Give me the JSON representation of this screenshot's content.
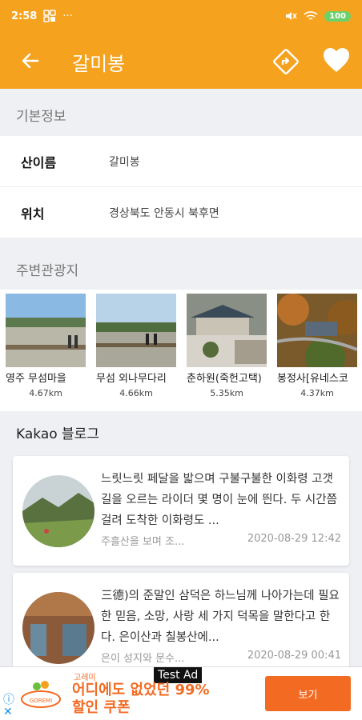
{
  "status": {
    "time": "2:58",
    "battery": "100"
  },
  "header": {
    "title": "갈미봉"
  },
  "basic_info": {
    "section_title": "기본정보",
    "rows": [
      {
        "label": "산이름",
        "value": "갈미봉"
      },
      {
        "label": "위치",
        "value": "경상북도 안동시 북후면"
      }
    ]
  },
  "nearby": {
    "section_title": "주변관광지",
    "items": [
      {
        "name": "영주 무섬마을",
        "distance": "4.67km"
      },
      {
        "name": "무섬 외나무다리",
        "distance": "4.66km"
      },
      {
        "name": "춘하원(죽헌고택)",
        "distance": "5.35km"
      },
      {
        "name": "봉정사[유네스코",
        "distance": "4.37km"
      }
    ]
  },
  "blog": {
    "section_title": "Kakao 블로그",
    "posts": [
      {
        "text": "느릿느릿 페달을 밟으며 구불구불한 이화령 고갯길을 오르는 라이더 몇 명이 눈에 띈다. 두 시간쯤 걸려 도착한 이화령도 ...",
        "source": "주흘산을 보며 조...",
        "date": "2020-08-29 12:42"
      },
      {
        "text": "三德)의 준말인 삼덕은 하느님께 나아가는데 필요한 믿음, 소망, 사랑 세 가지 덕목을 말한다고 한다. 은이산과 칠봉산에...",
        "source": "은이 성지와 문수...",
        "date": "2020-08-29 00:41"
      }
    ]
  },
  "ad": {
    "label": "Test Ad",
    "brand": "고레미",
    "headline_1": "어디에도 없었던 99%",
    "headline_2": "할인 쿠폰",
    "cta": "보기",
    "logo_text": "GOREMI"
  },
  "colors": {
    "primary": "#f5a21f",
    "ad_accent": "#f36b23"
  }
}
